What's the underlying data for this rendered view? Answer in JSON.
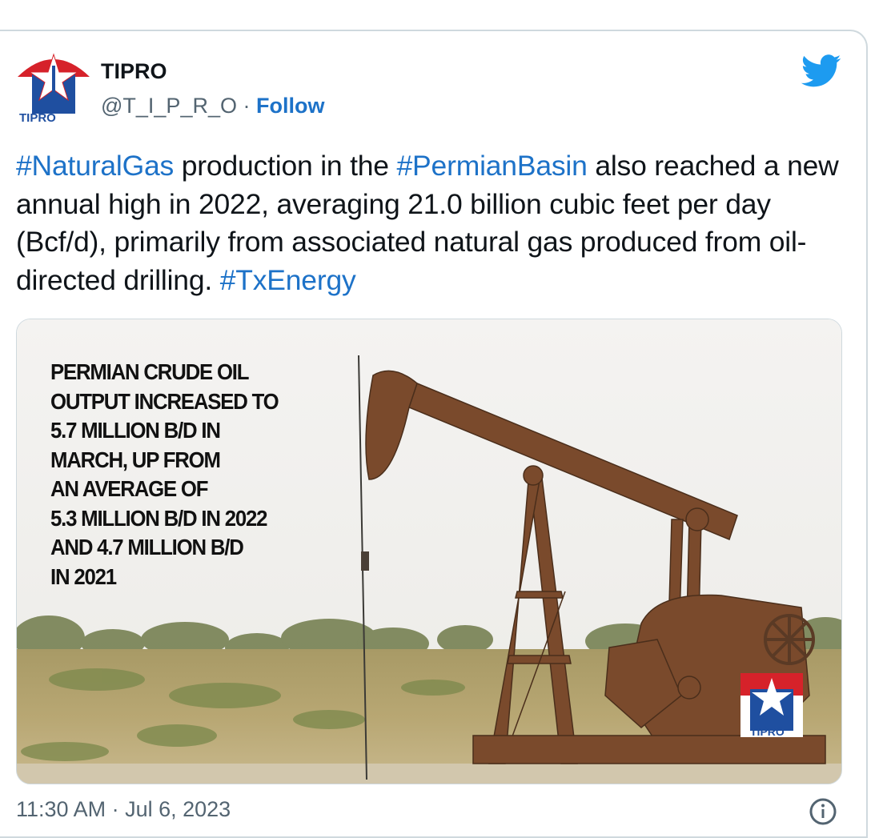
{
  "account": {
    "display_name": "TIPRO",
    "handle": "@T_I_P_R_O",
    "separator": "·",
    "follow_label": "Follow",
    "avatar_text": "TIPRO"
  },
  "tweet": {
    "segments": [
      {
        "text": "#NaturalGas",
        "hashtag": true
      },
      {
        "text": " production in the ",
        "hashtag": false
      },
      {
        "text": "#PermianBasin",
        "hashtag": true
      },
      {
        "text": " also reached a new annual high in 2022, averaging 21.0 billion cubic feet per day (Bcf/d), primarily from associated natural gas produced from oil-directed drilling. ",
        "hashtag": false
      },
      {
        "text": "#TxEnergy",
        "hashtag": true
      }
    ]
  },
  "media": {
    "overlay_lines": [
      "PERMIAN CRUDE OIL",
      "OUTPUT INCREASED TO",
      "5.7 MILLION B/D IN",
      "MARCH, UP FROM",
      "AN AVERAGE OF",
      "5.3 MILLION B/D IN 2022",
      "AND 4.7 MILLION B/D",
      "IN 2021"
    ],
    "logo_text": "TIPRO"
  },
  "footer": {
    "timestamp": "11:30 AM · Jul 6, 2023"
  },
  "colors": {
    "link": "#1d72c8",
    "twitter_blue": "#1d9bf0",
    "logo_red": "#d6222a",
    "logo_blue": "#1f4fa0"
  },
  "icons": [
    "twitter-bird-icon",
    "info-icon",
    "tipro-logo"
  ]
}
